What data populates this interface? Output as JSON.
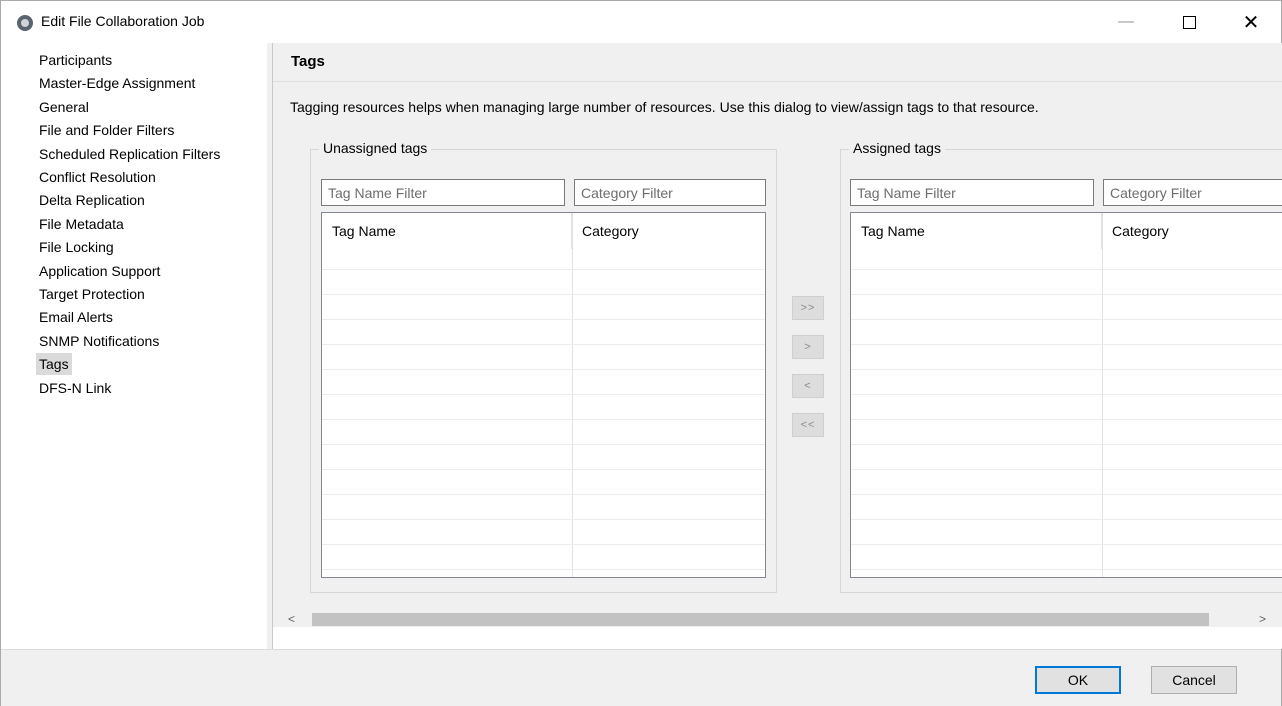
{
  "window": {
    "title": "Edit File Collaboration Job",
    "minimize_glyph": "—",
    "close_glyph": "✕"
  },
  "sidebar": {
    "items": [
      {
        "label": "Participants"
      },
      {
        "label": "Master-Edge Assignment"
      },
      {
        "label": "General"
      },
      {
        "label": "File and Folder Filters"
      },
      {
        "label": "Scheduled Replication Filters"
      },
      {
        "label": "Conflict Resolution"
      },
      {
        "label": "Delta Replication"
      },
      {
        "label": "File Metadata"
      },
      {
        "label": "File Locking"
      },
      {
        "label": "Application Support"
      },
      {
        "label": "Target Protection"
      },
      {
        "label": "Email Alerts"
      },
      {
        "label": "SNMP Notifications"
      },
      {
        "label": "Tags"
      },
      {
        "label": "DFS-N Link"
      }
    ],
    "selected": "Tags"
  },
  "panel": {
    "title": "Tags",
    "description": "Tagging resources helps when managing large number of resources. Use this dialog to view/assign tags to that resource."
  },
  "unassigned": {
    "label": "Unassigned tags",
    "tag_filter_placeholder": "Tag Name Filter",
    "category_filter_placeholder": "Category Filter",
    "columns": [
      "Tag Name",
      "Category"
    ],
    "rows": []
  },
  "assigned": {
    "label": "Assigned tags",
    "tag_filter_placeholder": "Tag Name Filter",
    "category_filter_placeholder": "Category Filter",
    "columns": [
      "Tag Name",
      "Category"
    ],
    "rows": []
  },
  "move_buttons": {
    "add_all": ">>",
    "add": ">",
    "remove": "<",
    "remove_all": "<<"
  },
  "scrollbar": {
    "left_arrow": "<",
    "right_arrow": ">"
  },
  "footer": {
    "ok_label": "OK",
    "cancel_label": "Cancel"
  },
  "colors": {
    "focus_border": "#0078d7",
    "selection_bg": "#dadada"
  }
}
